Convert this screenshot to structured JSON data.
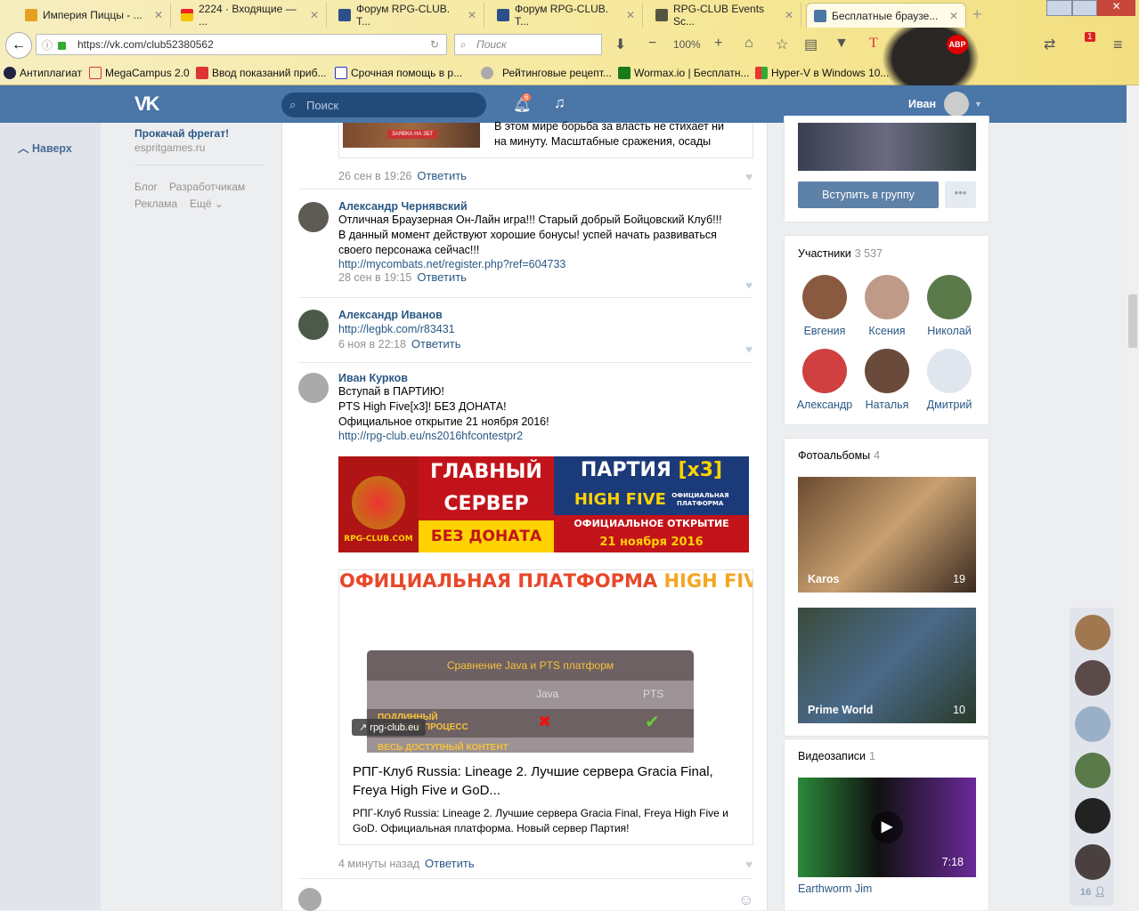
{
  "browser": {
    "tabs": [
      {
        "label": "Империя Пиццы - ...",
        "icon": "crown-icon"
      },
      {
        "label": "2224 · Входящие — ...",
        "icon": "mail-icon"
      },
      {
        "label": "Форум RPG-CLUB. T...",
        "icon": "rpg-club-icon"
      },
      {
        "label": "Форум RPG-CLUB. T...",
        "icon": "rpg-club-icon"
      },
      {
        "label": "RPG-CLUB Events Sc...",
        "icon": "rpg-events-icon"
      },
      {
        "label": "Бесплатные браузе...",
        "icon": "vk-icon"
      }
    ],
    "url": "https://vk.com/club52380562",
    "search_placeholder": "Поиск",
    "zoom": "100%",
    "abp": "ABP",
    "notif_badge": "1",
    "bookmarks": [
      "Антиплагиат",
      "MegaCampus 2.0",
      "Ввод показаний приб...",
      "Срочная помощь в р...",
      "Рейтинговые рецепт...",
      "Wormax.io | Бесплатн...",
      "Hyper-V в Windows 10..."
    ]
  },
  "vk": {
    "search_placeholder": "Поиск",
    "notif_count": "6",
    "user_name": "Иван",
    "to_top": "Наверх",
    "ad_title": "Прокачай фрегат!",
    "ad_domain": "espritgames.ru",
    "footer": [
      "Блог",
      "Разработчикам",
      "Реклама",
      "Ещё"
    ]
  },
  "feed": {
    "top_snippet": [
      "В этом мире борьба за власть не стихает ни",
      "на минуту. Масштабные сражения, осады"
    ],
    "top_banner_btn": "ЗАЯВКА НА ЗБТ",
    "top_meta": "26 сен в 19:26",
    "reply": "Ответить",
    "posts": [
      {
        "author": "Александр Чернявский",
        "lines": [
          "Отличная Браузерная Он-Лайн игра!!! Старый добрый Бойцовский Клуб!!!",
          "В данный момент действуют хорошие бонусы! успей начать развиваться",
          "своего персонажа сейчас!!!"
        ],
        "link": "http://mycombats.net/register.php?ref=604733",
        "meta": "28 сен в 19:15"
      },
      {
        "author": "Александр Иванов",
        "link": "http://legbk.com/r83431",
        "meta": "6 ноя в 22:18"
      },
      {
        "author": "Иван Курков",
        "lines": [
          "Вступай в ПАРТИЮ!",
          "PTS High Five[x3]! БЕЗ ДОНАТА!",
          "Официальное открытие 21 ноября 2016!"
        ],
        "link": "http://rpg-club.eu/ns2016hfcontestpr2",
        "meta": "4 минуты назад"
      }
    ],
    "banner": {
      "logo": "RPG-CLUB.COM",
      "l1": "ГЛАВНЫЙ",
      "l2": "СЕРВЕР",
      "l3": "БЕЗ ДОНАТА",
      "r1": "ПАРТИЯ",
      "r1b": "[x3]",
      "r2": "HIGH FIVE",
      "r2b": "ОФИЦИАЛЬНАЯ ПЛАТФОРМА",
      "r3": "ОФИЦИАЛЬНОЕ ОТКРЫТИЕ",
      "r4": "21 ноября 2016"
    },
    "snippet": {
      "headline_a": "ОФИЦИАЛЬНАЯ ПЛАТФОРМА ",
      "headline_b": "HIGH FIVE",
      "table_title": "Сравнение Java и PTS платформ",
      "col_java": "Java",
      "col_pts": "PTS",
      "row1": "ПОДЛИННЫЙ ИГРОВОЙ ПРОЦЕСС",
      "row2": "ВЕСЬ ДОСТУПНЫЙ КОНТЕНТ",
      "domain": "rpg-club.eu",
      "title": "РПГ-Клуб Russia: Lineage 2. Лучшие сервера Gracia Final, Freya High Five и GoD...",
      "desc": "РПГ-Клуб Russia: Lineage 2. Лучшие сервера Gracia Final, Freya High Five и GoD. Официальная платформа. Новый сервер Партия!"
    }
  },
  "right": {
    "join": "Вступить в группу",
    "members_label": "Участники",
    "members_count": "3 537",
    "members": [
      "Евгения",
      "Ксения",
      "Николай",
      "Александр",
      "Наталья",
      "Дмитрий"
    ],
    "albums_label": "Фотоальбомы",
    "albums_count": "4",
    "albums": [
      {
        "name": "Karos",
        "count": "19"
      },
      {
        "name": "Prime World",
        "count": "10"
      }
    ],
    "videos_label": "Видеозаписи",
    "videos_count": "1",
    "video": {
      "title": "Earthworm Jim",
      "duration": "7:18"
    }
  },
  "chat": {
    "online_count": "16"
  }
}
